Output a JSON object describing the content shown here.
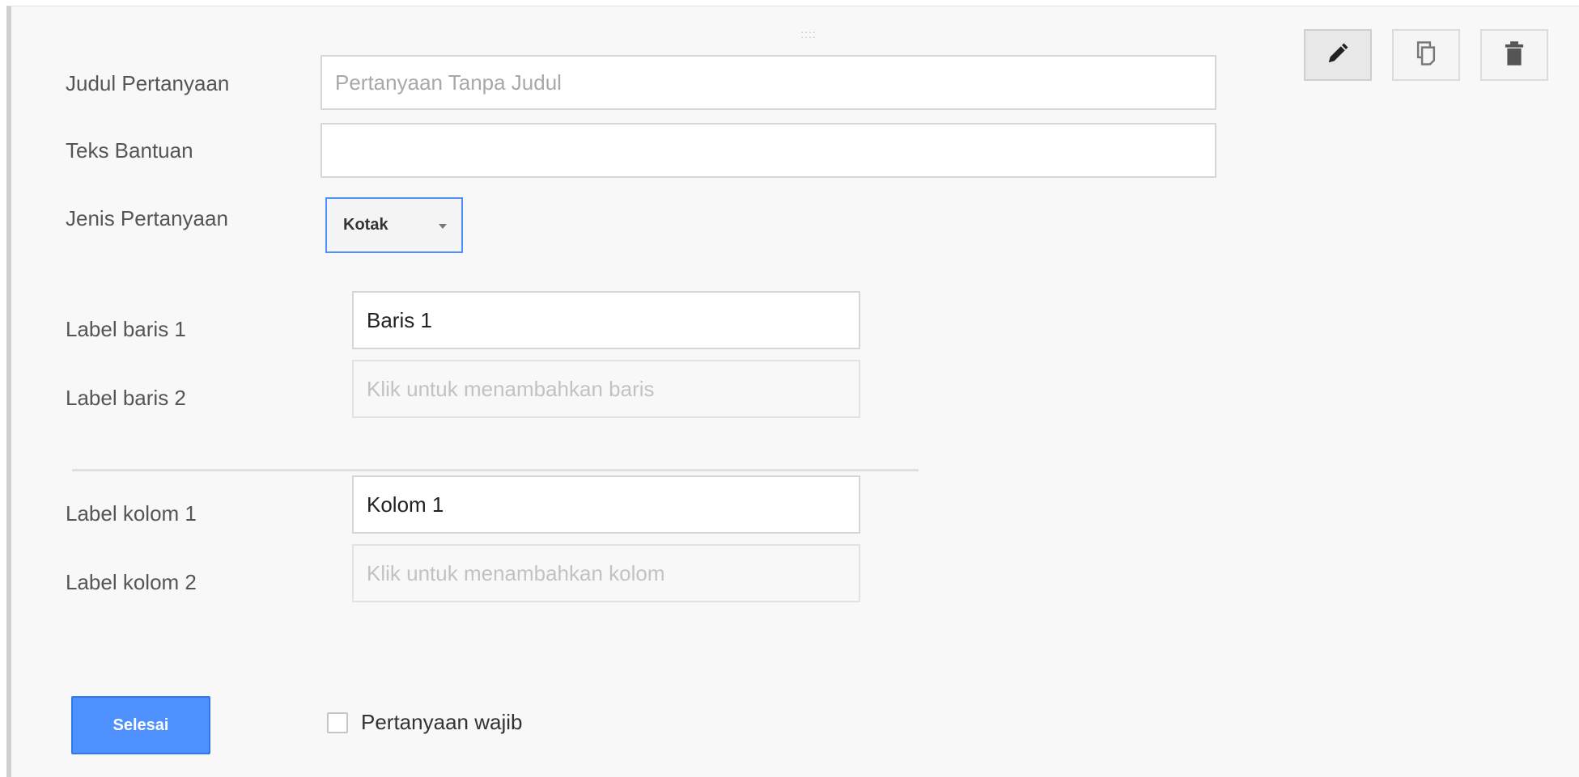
{
  "question_editor": {
    "drag_handle": "::::",
    "fields": {
      "title_label": "Judul Pertanyaan",
      "title_placeholder": "Pertanyaan Tanpa Judul",
      "title_value": "",
      "help_label": "Teks Bantuan",
      "help_value": "",
      "type_label": "Jenis Pertanyaan",
      "type_value": "Kotak"
    },
    "rows": [
      {
        "label": "Label baris 1",
        "value": "Baris 1",
        "placeholder": ""
      },
      {
        "label": "Label baris 2",
        "value": "",
        "placeholder": "Klik untuk menambahkan baris"
      }
    ],
    "columns": [
      {
        "label": "Label kolom 1",
        "value": "Kolom 1",
        "placeholder": ""
      },
      {
        "label": "Label kolom 2",
        "value": "",
        "placeholder": "Klik untuk menambahkan kolom"
      }
    ],
    "footer": {
      "done_label": "Selesai",
      "required_label": "Pertanyaan wajib",
      "required_checked": false
    },
    "toolbar": {
      "icons": [
        "pencil-icon",
        "copy-icon",
        "trash-icon"
      ]
    },
    "colors": {
      "accent": "#4d90fe",
      "card_background": "#f8f8f8",
      "left_bar": "#cfcfcf"
    }
  }
}
